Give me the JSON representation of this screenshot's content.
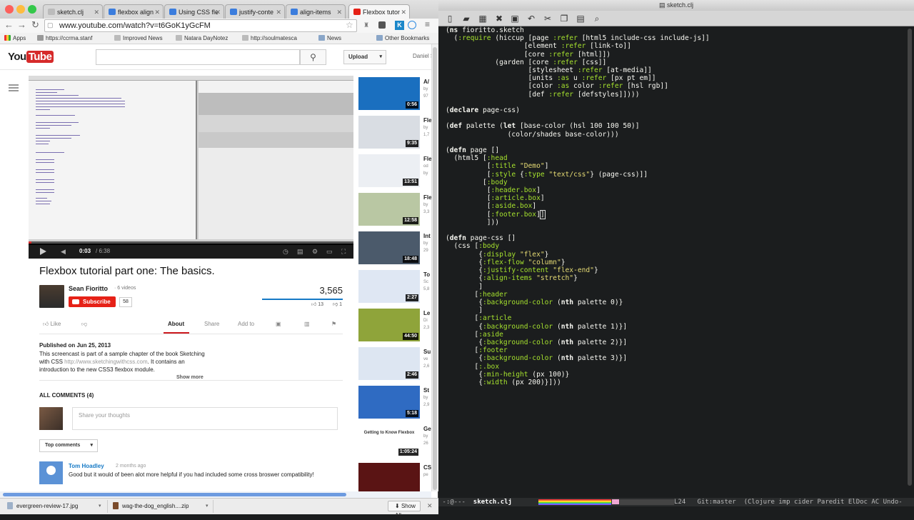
{
  "browser": {
    "tabs": [
      {
        "label": "sketch.clj",
        "color": "#bbbbbb"
      },
      {
        "label": "flexbox align",
        "color": "#3b7ddd"
      },
      {
        "label": "Using CSS fle",
        "color": "#3b7ddd"
      },
      {
        "label": "justify-conte",
        "color": "#3b7ddd"
      },
      {
        "label": "align-items",
        "color": "#3b7ddd"
      },
      {
        "label": "Flexbox tutor",
        "color": "#e62117"
      }
    ],
    "url": "www.youtube.com/watch?v=t6GoK1yGcFM",
    "bookmarks": {
      "apps": "Apps",
      "items": [
        "https://ccrma.stanf",
        "Improved News",
        "Natara DayNotez",
        "http://soulmatesca",
        "News"
      ],
      "other": "Other Bookmarks"
    }
  },
  "youtube": {
    "logo_you": "You",
    "logo_tube": "Tube",
    "upload_label": "Upload",
    "username": "Daniel S",
    "player": {
      "current_time": "0:03",
      "total_time": "/ 6:38",
      "progress_fraction": 0.008
    },
    "video_title": "Flexbox tutorial part one: The basics.",
    "channel_name": "Sean Fioritto",
    "video_count": "· 6 videos",
    "subscribe_label": "Subscribe",
    "subscriber_count": "58",
    "view_count": "3,565",
    "like_count": "13",
    "dislike_count": "1",
    "actions": {
      "like": "Like",
      "about": "About",
      "share": "Share",
      "add_to": "Add to"
    },
    "published": "Published on Jun 25, 2013",
    "description_1": "This screencast is part of a sample chapter of the book Sketching",
    "description_2a": "with CSS ",
    "description_link": "http://www.sketchingwithcss.com",
    "description_2b": ". It contains an",
    "description_3": "introduction to the new CSS3 flexbox module.",
    "show_more": "Show more",
    "all_comments": "ALL COMMENTS (4)",
    "comment_placeholder": "Share your thoughts",
    "top_comments": "Top comments",
    "comment": {
      "author": "Tom Hoadley",
      "time": "2 months ago",
      "text": "Good but it would of been alot more helpful if you had included some cross broswer compatibility!"
    },
    "recommended": [
      {
        "title": "A/",
        "meta": "by",
        "meta2": "97",
        "duration": "0:56",
        "color": "#1a6fbf"
      },
      {
        "title": "Fle",
        "meta": "by",
        "meta2": "1,7",
        "duration": "9:35",
        "color": "#d9dde3"
      },
      {
        "title": "Fle",
        "meta": "od",
        "meta2": "by",
        "duration": "13:51",
        "color": "#eceff3"
      },
      {
        "title": "Fle",
        "meta": "by",
        "meta2": "3,3",
        "duration": "12:58",
        "color": "#b9c7a3"
      },
      {
        "title": "Int",
        "meta": "by",
        "meta2": "29",
        "duration": "18:48",
        "color": "#4b5a6b"
      },
      {
        "title": "To",
        "meta": "Sc",
        "meta2": "5,8",
        "duration": "2:27",
        "color": "#dfe7f3"
      },
      {
        "title": "Le",
        "meta": "Di",
        "meta2": "2,3",
        "duration": "44:50",
        "color": "#8fa43a"
      },
      {
        "title": "Su",
        "meta": "ve",
        "meta2": "2,6",
        "duration": "2:46",
        "color": "#dde6f2"
      },
      {
        "title": "St",
        "meta": "by",
        "meta2": "2,9",
        "duration": "5:18",
        "color": "#2f6bc2"
      },
      {
        "title": "Ge",
        "meta": "by",
        "meta2": "26",
        "duration": "1:05:24",
        "color": "#ffffff",
        "thumb_text": "Getting to Know Flexbox"
      },
      {
        "title": "CS",
        "meta": "pe",
        "meta2": "",
        "duration": "",
        "color": "#5a1414"
      }
    ]
  },
  "downloads": {
    "items": [
      "evergreen-review-17.jpg",
      "wag-the-dog_english....zip"
    ],
    "show_all": "Show All"
  },
  "editor": {
    "title": "sketch.clj",
    "modeline": {
      "prefix": "-:@---",
      "buffer": "sketch.clj",
      "line": "L24",
      "branch": "Git:master",
      "modes": "(Clojure imp cider Paredit ElDoc AC Undo-"
    }
  }
}
